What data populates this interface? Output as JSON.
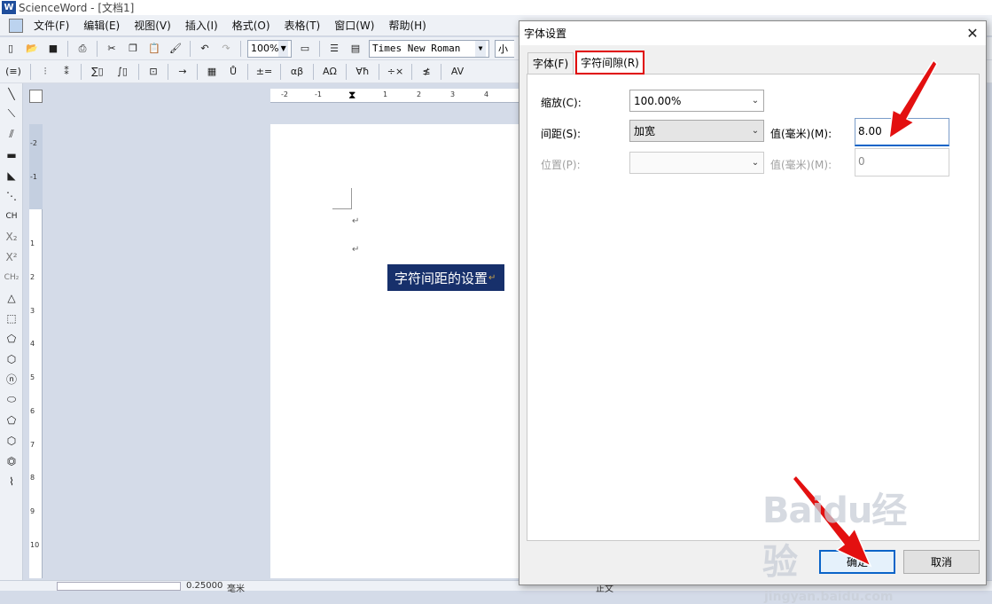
{
  "app": {
    "title": "ScienceWord - [文档1]",
    "icon_label": "W"
  },
  "menubar": {
    "items": [
      "文件(F)",
      "编辑(E)",
      "视图(V)",
      "插入(I)",
      "格式(O)",
      "表格(T)",
      "窗口(W)",
      "帮助(H)"
    ]
  },
  "toolbar1": {
    "zoom": "100%",
    "font_name": "Times New Roman",
    "font_size": "小"
  },
  "toolbar2": {
    "labels": [
      "(≡)",
      "∑▯",
      "∫▯",
      "→",
      "±=",
      "αβ",
      "ΑΩ",
      "∀ħ",
      "÷×",
      "AV"
    ]
  },
  "leftcol": {
    "labels": [
      "CH",
      "X₂",
      "X²",
      "CH₂"
    ]
  },
  "ruler": {
    "horizontal": [
      "-2",
      "-1",
      "1",
      "2",
      "3",
      "4"
    ],
    "vertical": [
      "-2",
      "-1",
      "1",
      "2",
      "3",
      "4",
      "5",
      "6",
      "7",
      "8",
      "9",
      "10"
    ]
  },
  "document": {
    "selected_text": "字符间距的设置",
    "paragraph_mark": "↵"
  },
  "statusbar": {
    "width_value": "0.25000",
    "unit": "毫米",
    "style": "正文"
  },
  "dialog": {
    "title": "字体设置",
    "tabs": [
      "字体(F)",
      "字符间隙(R)"
    ],
    "scale_label": "缩放(C):",
    "scale_value": "100.00%",
    "spacing_label": "间距(S):",
    "spacing_value": "加宽",
    "spacing_mm_label": "值(毫米)(M):",
    "spacing_mm_value": "8.00",
    "position_label": "位置(P):",
    "position_value": "",
    "position_mm_label": "值(毫米)(M):",
    "position_mm_value": "0",
    "ok_label": "确定",
    "cancel_label": "取消"
  },
  "watermark": {
    "brand": "Baidu经验",
    "url": "jingyan.baidu.com"
  },
  "colors": {
    "selection_bg": "#17306b",
    "highlight_red": "#e00000",
    "focus_blue": "#0a64c8"
  }
}
